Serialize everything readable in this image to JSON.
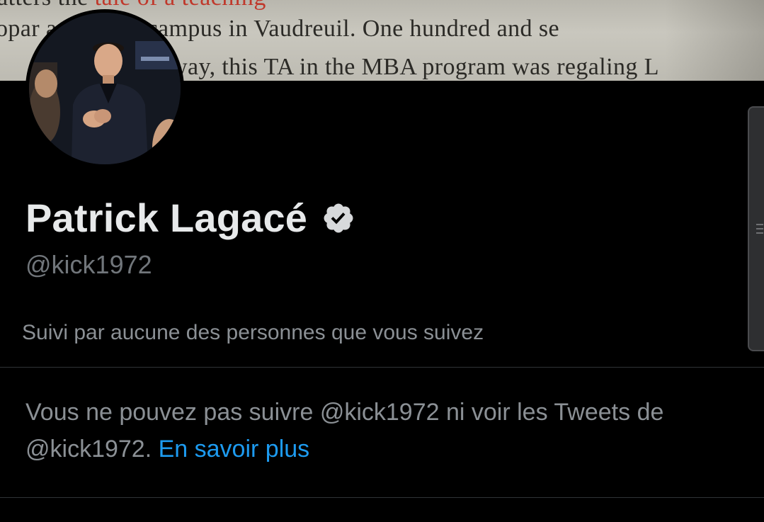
{
  "banner": {
    "line1_prefix": "atters the ",
    "line1_red": "tale of a teaching",
    "line2": "opar           a satellite campus in Vaudreuil. One hundred and se",
    "line3": "way, this TA in the MBA program was regaling L"
  },
  "profile": {
    "display_name": "Patrick Lagacé",
    "handle": "@kick1972",
    "followed_by": "Suivi par aucune des personnes que vous suivez"
  },
  "notice": {
    "text": "Vous ne pouvez pas suivre @kick1972 ni voir les Tweets de @kick1972.",
    "link": "En savoir plus"
  },
  "colors": {
    "background": "#000000",
    "name": "#e7e9ea",
    "secondary": "#71767b",
    "link": "#1d9bf0"
  },
  "icons": {
    "verified": "verified-badge-icon",
    "scroll": "scrollbar-grip-icon"
  }
}
